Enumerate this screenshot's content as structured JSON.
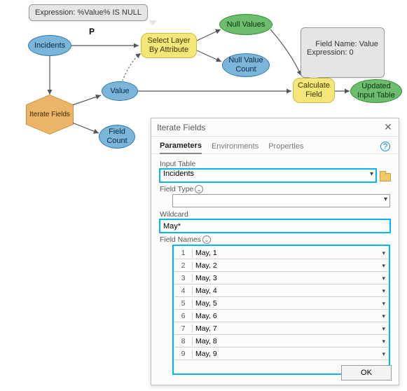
{
  "callouts": {
    "expr": "Expression: %Value% IS NULL",
    "field": "Field Name: Value\nExpression: 0"
  },
  "diagram": {
    "p_label": "P",
    "incidents": "Incidents",
    "iterate_fields": "Iterate Fields",
    "value": "Value",
    "field_count": "Field\nCount",
    "select_layer": "Select Layer\nBy Attribute",
    "null_values": "Null Values",
    "null_value_count": "Null Value\nCount",
    "calculate_field": "Calculate\nField",
    "updated_input_table": "Updated\nInput Table"
  },
  "dialog": {
    "title": "Iterate Fields",
    "tabs": {
      "parameters": "Parameters",
      "environments": "Environments",
      "properties": "Properties"
    },
    "labels": {
      "input_table": "Input Table",
      "field_type": "Field Type",
      "wildcard": "Wildcard",
      "field_names": "Field Names"
    },
    "values": {
      "input_table": "Incidents",
      "field_type": "",
      "wildcard": "May*"
    },
    "field_rows": [
      "May, 1",
      "May, 2",
      "May, 3",
      "May, 4",
      "May, 5",
      "May, 6",
      "May, 7",
      "May, 8",
      "May, 9"
    ],
    "ok": "OK"
  }
}
